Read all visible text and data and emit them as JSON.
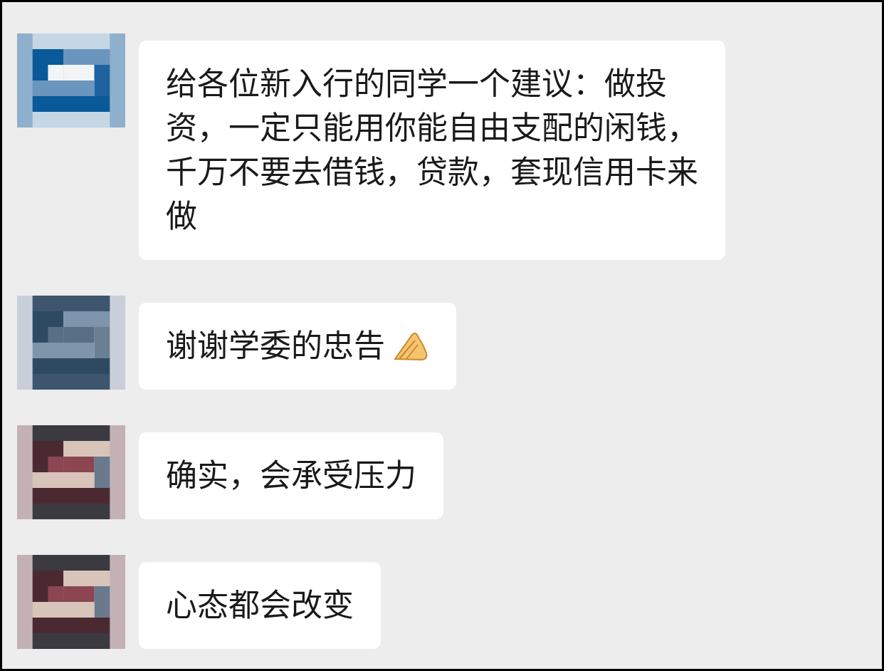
{
  "messages": [
    {
      "text": "给各位新入行的同学一个建议：做投资，一定只能用你能自由支配的闲钱，千万不要去借钱，贷款，套现信用卡来做",
      "has_icon": false
    },
    {
      "text": "谢谢学委的忠告",
      "has_icon": true
    },
    {
      "text": "确实，会承受压力",
      "has_icon": false
    },
    {
      "text": "心态都会改变",
      "has_icon": false
    }
  ]
}
